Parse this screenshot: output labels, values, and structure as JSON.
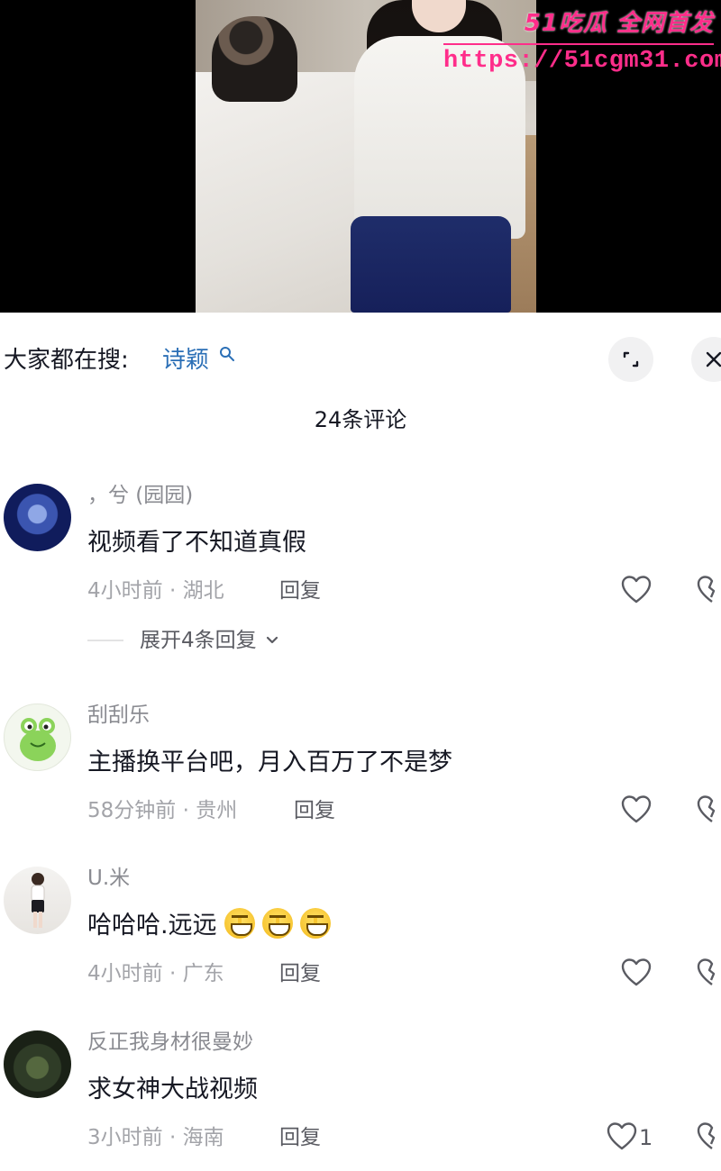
{
  "watermark": {
    "brand": "51吃瓜 全网首发",
    "url": "https://51cgm31.com"
  },
  "search": {
    "prefix": "大家都在搜:",
    "term": "诗颖"
  },
  "comments_header": {
    "count_label": "24条评论"
  },
  "reply_label": "回复",
  "comments": [
    {
      "user": "，兮 (园园)",
      "text": "视频看了不知道真假",
      "meta": "4小时前 · 湖北",
      "likes": "",
      "avatar_colors": [
        "#1b2a7a",
        "#5a79c9"
      ]
    },
    {
      "user": "刮刮乐",
      "text": "主播换平台吧，月入百万了不是梦",
      "meta": "58分钟前 · 贵州",
      "likes": "",
      "avatar_colors": [
        "#e8f4d8",
        "#7cc74a"
      ]
    },
    {
      "user": "U.米",
      "text": "哈哈哈.远远",
      "meta": "4小时前 · 广东",
      "likes": "",
      "avatar_colors": [
        "#f2f2f0",
        "#d9d6d2"
      ]
    },
    {
      "user": "反正我身材很曼妙",
      "text": "求女神大战视频",
      "meta": "3小时前 · 海南",
      "likes": "1",
      "avatar_colors": [
        "#2c3a2a",
        "#6b7b5a"
      ]
    }
  ],
  "expand_replies": {
    "label": "展开4条回复"
  },
  "icons": {
    "search": "search-icon",
    "expand": "expand-icon",
    "close": "close-icon",
    "like": "heart-icon",
    "dislike": "broken-heart-icon",
    "chevron": "chevron-down-icon",
    "emoji": "grinning-face-emoji"
  },
  "colors": {
    "link": "#2b6fb6",
    "watermark": "#ff2d8a",
    "muted_text": "#a3a4a9"
  }
}
